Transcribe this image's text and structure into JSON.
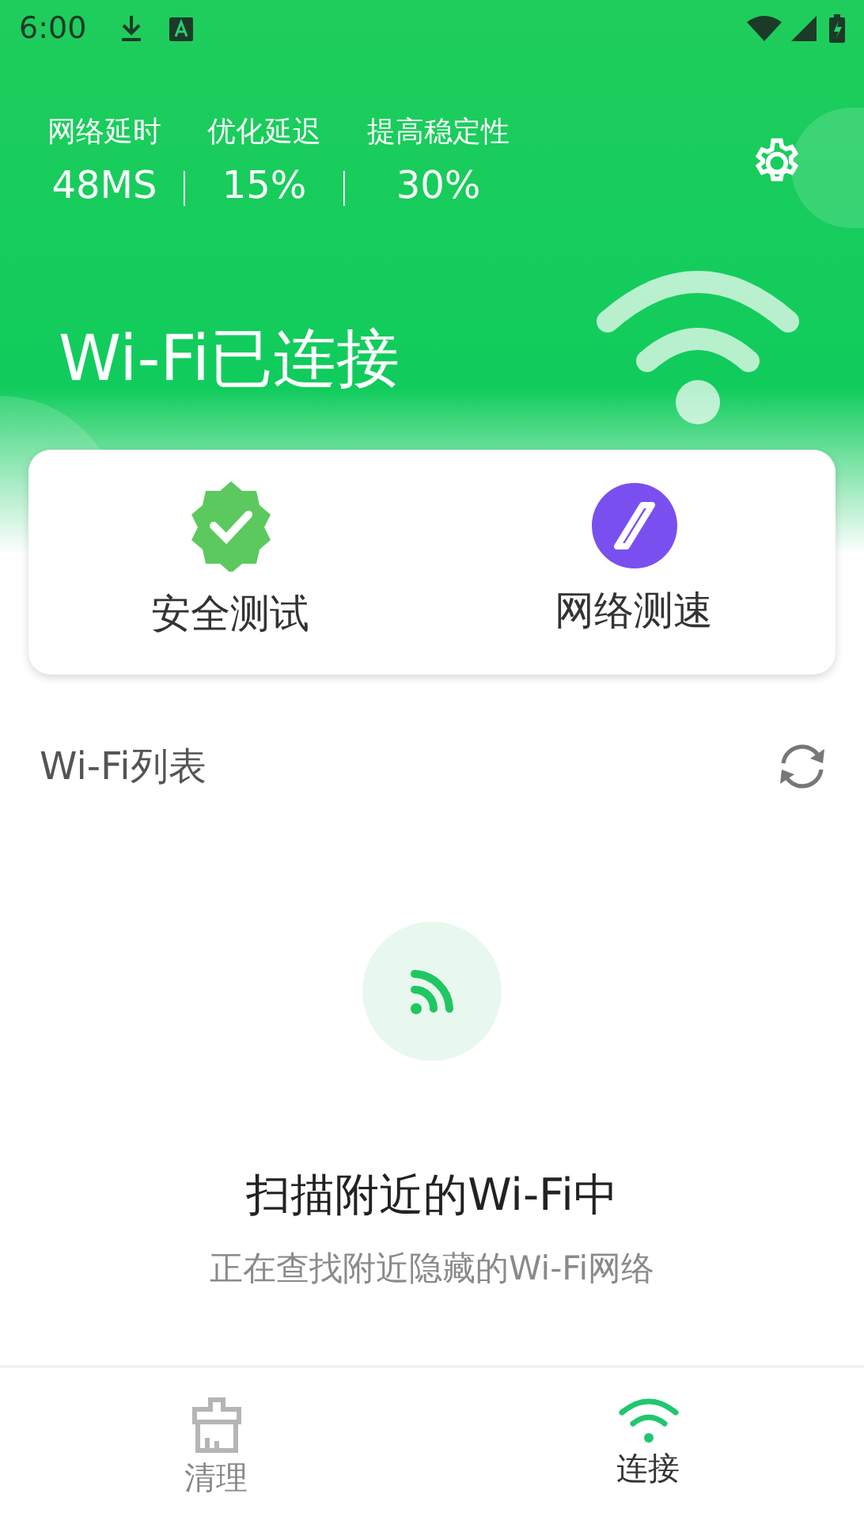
{
  "status_bar": {
    "time": "6:00"
  },
  "stats": [
    {
      "label": "网络延时",
      "value": "48MS"
    },
    {
      "label": "优化延迟",
      "value": "15%"
    },
    {
      "label": "提高稳定性",
      "value": "30%"
    }
  ],
  "title": "Wi-Fi已连接",
  "actions": [
    {
      "kind": "security",
      "label": "安全测试"
    },
    {
      "kind": "speed",
      "label": "网络测速"
    }
  ],
  "wifi_list": {
    "title": "Wi-Fi列表"
  },
  "scanning": {
    "title": "扫描附近的Wi-Fi中",
    "subtitle": "正在查找附近隐藏的Wi-Fi网络"
  },
  "bottom_nav": [
    {
      "kind": "clean",
      "label": "清理",
      "selected": false
    },
    {
      "kind": "connect",
      "label": "连接",
      "selected": true
    }
  ]
}
